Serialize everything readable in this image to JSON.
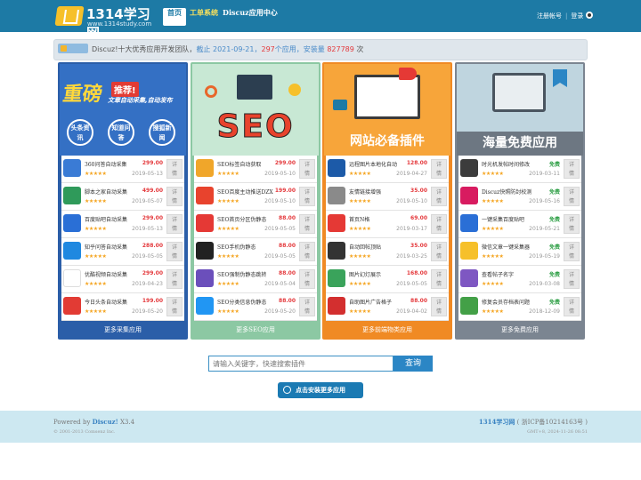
{
  "header": {
    "logo_name": "1314学习网",
    "logo_url": "www.1314study.com",
    "nav": [
      {
        "label": "首页"
      },
      {
        "label": "工单系统"
      },
      {
        "label": "Discuz应用中心"
      }
    ],
    "register": "注册帐号",
    "separator": "|",
    "login": "登录"
  },
  "notice": {
    "badge": "动态",
    "p1": "Discuz!十大优秀应用开发团队，",
    "p2": "截止 2021-09-21，",
    "apps_count": "297",
    "p3": "个应用，安装量 ",
    "installs": "827789",
    "p4": " 次"
  },
  "columns": [
    {
      "id": "collect",
      "bg": "#2b5ea8",
      "more": "更多采集应用",
      "banner": {
        "headline": "重磅",
        "sub": "推荐!",
        "line": "文章自动采集,自动发布",
        "tags": [
          "头条资讯",
          "知道问答",
          "搜狐新闻"
        ]
      },
      "items": [
        {
          "title": "360问答自动采集",
          "price": "299.00",
          "stars": "★★★★★",
          "date": "2019-05-13",
          "detail": "详情",
          "icon": "#3a7bd5"
        },
        {
          "title": "脚本之家自动采集",
          "price": "499.00",
          "stars": "★★★★★",
          "date": "2019-05-07",
          "detail": "详情",
          "icon": "#2f9a5a"
        },
        {
          "title": "百度贴吧自动采集",
          "price": "299.00",
          "stars": "★★★★★",
          "date": "2019-05-13",
          "detail": "详情",
          "icon": "#2a6fd6"
        },
        {
          "title": "知乎问答自动采集",
          "price": "288.00",
          "stars": "★★★★★",
          "date": "2019-05-05",
          "detail": "详情",
          "icon": "#1f88e0"
        },
        {
          "title": "优酷视频自动采集",
          "price": "299.00",
          "stars": "★★★★★",
          "date": "2019-04-23",
          "detail": "详情",
          "icon": "#ffffff"
        },
        {
          "title": "今日头条自动采集",
          "price": "199.00",
          "stars": "★★★★★",
          "date": "2019-05-20",
          "detail": "详情",
          "icon": "#e23b34"
        }
      ]
    },
    {
      "id": "seo",
      "bg": "#8cc8a3",
      "more": "更多SEO应用",
      "banner": {
        "headline": "SEO"
      },
      "items": [
        {
          "title": "SEO标签自动获取",
          "price": "299.00",
          "stars": "★★★★★",
          "date": "2019-05-10",
          "detail": "详情",
          "icon": "#f0a62a"
        },
        {
          "title": "SEO百度主动推送DZX",
          "price": "199.00",
          "stars": "★★★★★",
          "date": "2019-05-10",
          "detail": "详情",
          "icon": "#e8432d"
        },
        {
          "title": "SEO首页分区伪静态",
          "price": "88.00",
          "stars": "★★★★★",
          "date": "2019-05-05",
          "detail": "详情",
          "icon": "#e53935"
        },
        {
          "title": "SEO手机伪静态",
          "price": "88.00",
          "stars": "★★★★★",
          "date": "2019-05-05",
          "detail": "详情",
          "icon": "#222222"
        },
        {
          "title": "SEO强制伪静态跳转",
          "price": "88.00",
          "stars": "★★★★★",
          "date": "2019-05-04",
          "detail": "详情",
          "icon": "#6b4fbb"
        },
        {
          "title": "SEO分类信息伪静态",
          "price": "88.00",
          "stars": "★★★★★",
          "date": "2019-05-20",
          "detail": "详情",
          "icon": "#2196f3"
        }
      ]
    },
    {
      "id": "plugins",
      "bg": "#f08a24",
      "more": "更多前端物类应用",
      "banner": {
        "headline": "网站必备插件"
      },
      "items": [
        {
          "title": "远程图片本地化自动",
          "price": "128.00",
          "stars": "★★★★★",
          "date": "2019-04-27",
          "detail": "详情",
          "icon": "#1c5aa8"
        },
        {
          "title": "友情链接增强",
          "price": "35.00",
          "stars": "★★★★★",
          "date": "2019-05-10",
          "detail": "详情",
          "icon": "#8a8a8a"
        },
        {
          "title": "首页N格",
          "price": "69.00",
          "stars": "★★★★★",
          "date": "2019-03-17",
          "detail": "详情",
          "icon": "#e53935"
        },
        {
          "title": "自动回帖顶贴",
          "price": "35.00",
          "stars": "★★★★★",
          "date": "2019-03-25",
          "detail": "详情",
          "icon": "#333333"
        },
        {
          "title": "图片幻灯展示",
          "price": "168.00",
          "stars": "★★★★★",
          "date": "2019-05-05",
          "detail": "详情",
          "icon": "#3aa35b"
        },
        {
          "title": "自助图片广告格子",
          "price": "88.00",
          "stars": "★★★★★",
          "date": "2019-04-02",
          "detail": "详情",
          "icon": "#d32f2f"
        }
      ]
    },
    {
      "id": "free",
      "bg": "#7b8591",
      "more": "更多免费应用",
      "banner": {
        "headline": "海量免费应用"
      },
      "items": [
        {
          "title": "时光机发帖时间修改",
          "price": "免费",
          "stars": "★★★★★",
          "date": "2019-03-11",
          "detail": "详情",
          "icon": "#3c3c3c"
        },
        {
          "title": "Discuz快照防封校测",
          "price": "免费",
          "stars": "★★★★★",
          "date": "2019-05-16",
          "detail": "详情",
          "icon": "#d81b60"
        },
        {
          "title": "一键采集百度贴吧",
          "price": "免费",
          "stars": "★★★★★",
          "date": "2019-05-21",
          "detail": "详情",
          "icon": "#2a6fd6"
        },
        {
          "title": "微信文章一键采集器",
          "price": "免费",
          "stars": "★★★★★",
          "date": "2019-05-19",
          "detail": "详情",
          "icon": "#f6c02a"
        },
        {
          "title": "查看帖子名字",
          "price": "免费",
          "stars": "★★★★★",
          "date": "2019-03-08",
          "detail": "详情",
          "icon": "#7e57c2"
        },
        {
          "title": "修复会员存档表问题",
          "price": "免费",
          "stars": "★★★★★",
          "date": "2018-12-09",
          "detail": "详情",
          "icon": "#43a047"
        }
      ]
    }
  ],
  "search": {
    "placeholder": "请输入关键字，快速搜索插件",
    "button": "查询"
  },
  "install_button": "点击安装更多应用",
  "footer": {
    "powered_prefix": "Powered by ",
    "powered_brand": "Discuz!",
    "powered_ver": " X3.4",
    "copyright": "© 2001-2013 Comsenz Inc.",
    "site": "1314学习网",
    "icp": " ( 浙ICP备10214163号 )",
    "time": "GMT+8, 2024-11-26 08:51"
  }
}
